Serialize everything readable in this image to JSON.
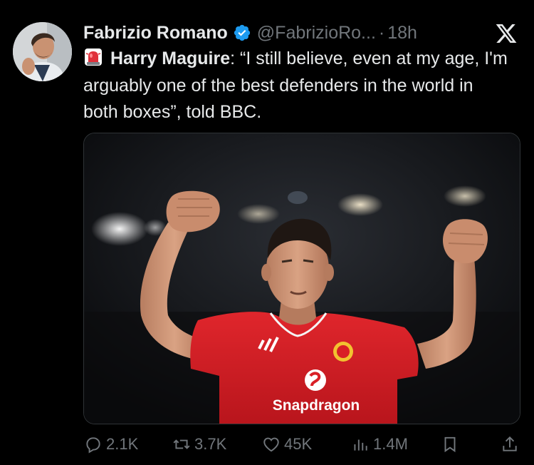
{
  "author": {
    "name": "Fabrizio Romano",
    "handle": "@FabrizioRo...",
    "separator": "·",
    "time": "18h",
    "verified_color": "#1d9bf0"
  },
  "tweet": {
    "siren_icon": "rotating-light-emoji",
    "bold_part": "Harry Maguire",
    "rest_part": ": “I still believe, even at my age, I'm arguably one of the best defenders in the world in both boxes”, told BBC."
  },
  "media": {
    "sponsor_text": "Snapdragon",
    "shirt_color": "#d91f26"
  },
  "actions": {
    "replies": "2.1K",
    "reposts": "3.7K",
    "likes": "45K",
    "views": "1.4M"
  },
  "icons": {
    "platform": "x-logo-icon"
  }
}
